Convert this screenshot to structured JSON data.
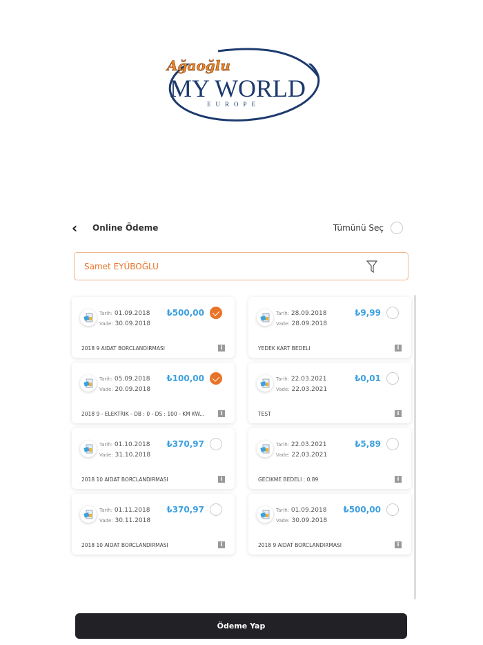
{
  "logo": {
    "brand": "Ağaoğlu",
    "name": "MY WORLD",
    "sub": "EUROPE"
  },
  "header": {
    "title": "Online Ödeme",
    "select_all": "Tümünü Seç"
  },
  "search": {
    "value": "Samet EYÜBOĞLU"
  },
  "labels": {
    "tarih": "Tarih:",
    "vade": "Vade:"
  },
  "colors": {
    "accent": "#e8742a",
    "amount": "#3da0e0"
  },
  "cards": [
    {
      "tarih": "01.09.2018",
      "vade": "30.09.2018",
      "amount": "₺500,00",
      "desc": "2018 9 AIDAT BORCLANDIRMASI",
      "selected": true
    },
    {
      "tarih": "28.09.2018",
      "vade": "28.09.2018",
      "amount": "₺9,99",
      "desc": "YEDEK KART BEDELI",
      "selected": false
    },
    {
      "tarih": "05.09.2018",
      "vade": "20.09.2018",
      "amount": "₺100,00",
      "desc": "2018 9 - ELEKTRIK - DB : 0 - DS : 100 - KM KW...",
      "selected": true
    },
    {
      "tarih": "22.03.2021",
      "vade": "22.03.2021",
      "amount": "₺0,01",
      "desc": "TEST",
      "selected": false
    },
    {
      "tarih": "01.10.2018",
      "vade": "31.10.2018",
      "amount": "₺370,97",
      "desc": "2018 10 AIDAT BORCLANDIRMASI",
      "selected": false
    },
    {
      "tarih": "22.03.2021",
      "vade": "22.03.2021",
      "amount": "₺5,89",
      "desc": "GECIKME BEDELI : 0.89",
      "selected": false
    },
    {
      "tarih": "01.11.2018",
      "vade": "30.11.2018",
      "amount": "₺370,97",
      "desc": "2018 10 AIDAT BORCLANDIRMASI",
      "selected": false
    },
    {
      "tarih": "01.09.2018",
      "vade": "30.09.2018",
      "amount": "₺500,00",
      "desc": "2018 9 AIDAT BORCLANDIRMASI",
      "selected": false
    }
  ],
  "pay_button": "Ödeme Yap"
}
